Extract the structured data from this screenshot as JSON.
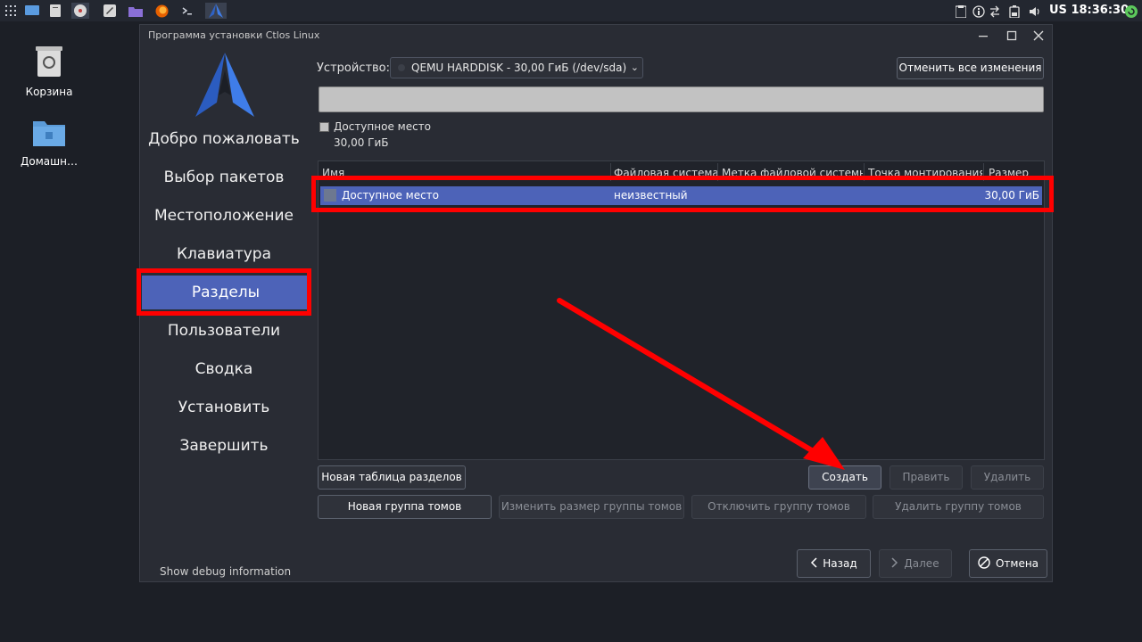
{
  "taskbar": {
    "icons": [
      "apps-grid-icon",
      "desktop-icon",
      "file-icon",
      "disk-icon",
      "text-editor-icon",
      "folder-icon",
      "firefox-icon",
      "terminal-icon",
      "ctlos-icon"
    ],
    "clock": "US 18:36:30"
  },
  "desktop": {
    "items": [
      {
        "label": "Корзина"
      },
      {
        "label": "Домашн…"
      }
    ]
  },
  "window": {
    "title": "Программа установки Ctlos Linux"
  },
  "sidebar": {
    "items": [
      {
        "label": "Добро пожаловать"
      },
      {
        "label": "Выбор пакетов"
      },
      {
        "label": "Местоположение"
      },
      {
        "label": "Клавиатура"
      },
      {
        "label": "Разделы"
      },
      {
        "label": "Пользователи"
      },
      {
        "label": "Сводка"
      },
      {
        "label": "Установить"
      },
      {
        "label": "Завершить"
      }
    ],
    "active_index": 4,
    "debug_label": "Show debug information"
  },
  "device": {
    "label": "Устройство:",
    "selected": "QEMU HARDDISK - 30,00 ГиБ (/dev/sda)",
    "revert_label": "Отменить все изменения"
  },
  "legend": {
    "label": "Доступное место",
    "size": "30,00 ГиБ"
  },
  "table": {
    "columns": [
      "Имя",
      "Файловая система",
      "Метка файловой системы",
      "Точка монтирования",
      "Размер"
    ],
    "rows": [
      {
        "name": "Доступное место",
        "fs": "неизвестный",
        "label": "",
        "mount": "",
        "size": "30,00 ГиБ"
      }
    ]
  },
  "buttons": {
    "new_table": "Новая таблица разделов",
    "create": "Создать",
    "edit": "Править",
    "delete": "Удалить",
    "new_vg": "Новая группа томов",
    "resize_vg": "Изменить размер группы томов",
    "deactivate_vg": "Отключить группу томов",
    "remove_vg": "Удалить группу томов",
    "back": "Назад",
    "next": "Далее",
    "cancel": "Отмена"
  },
  "colors": {
    "accent": "#4d63b8",
    "highlight": "#ff0000",
    "background": "#1c1f26",
    "window": "#292c34"
  }
}
